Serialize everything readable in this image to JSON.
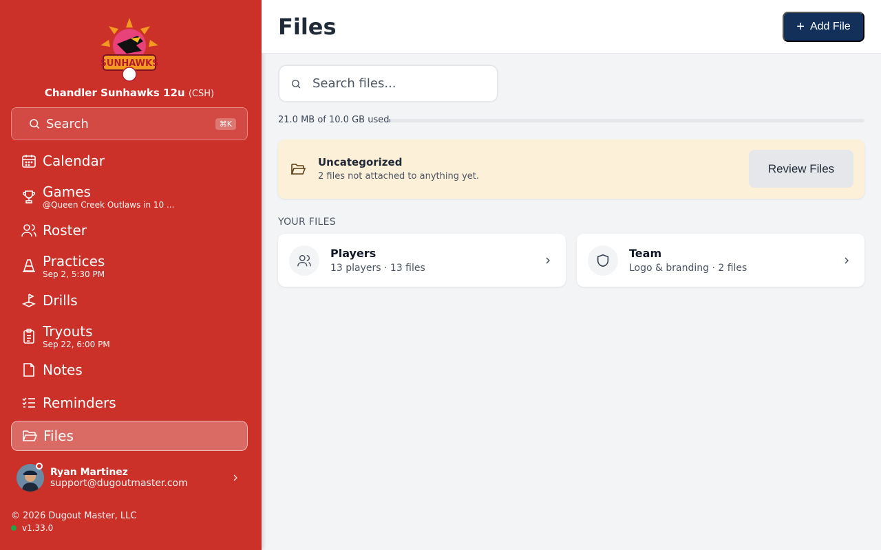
{
  "sidebar": {
    "team_name": "Chandler Sunhawks 12u",
    "team_abbr": "(CSH)",
    "logo_text": "SUNHAWKS",
    "search_label": "Search",
    "search_shortcut": "⌘K",
    "nav": [
      {
        "label": "Calendar",
        "sub": ""
      },
      {
        "label": "Games",
        "sub": "@Queen Creek Outlaws in 10 ..."
      },
      {
        "label": "Roster",
        "sub": ""
      },
      {
        "label": "Practices",
        "sub": "Sep 2, 5:30 PM"
      },
      {
        "label": "Drills",
        "sub": ""
      },
      {
        "label": "Tryouts",
        "sub": "Sep 22, 6:00 PM"
      },
      {
        "label": "Notes",
        "sub": ""
      },
      {
        "label": "Reminders",
        "sub": ""
      },
      {
        "label": "Files",
        "sub": ""
      }
    ],
    "active_item": "Files",
    "user": {
      "name": "Ryan Martinez",
      "email": "support@dugoutmaster.com"
    },
    "copyright": "© 2026 Dugout Master, LLC",
    "version": "v1.33.0"
  },
  "header": {
    "title": "Files",
    "add_button": "Add File"
  },
  "main": {
    "search_placeholder": "Search files...",
    "usage_text": "21.0 MB of 10.0 GB used",
    "usage_fraction": 0.002,
    "uncategorized": {
      "title": "Uncategorized",
      "subtitle": "2 files not attached to anything yet.",
      "button": "Review Files"
    },
    "section_title": "YOUR FILES",
    "cards": [
      {
        "title": "Players",
        "subtitle": "13 players · 13 files",
        "icon": "users-icon"
      },
      {
        "title": "Team",
        "subtitle": "Logo & branding · 2 files",
        "icon": "shield-icon"
      }
    ]
  },
  "colors": {
    "sidebar": "#cc3129",
    "primary": "#12305a",
    "warning_bg": "#fdf0d9"
  }
}
